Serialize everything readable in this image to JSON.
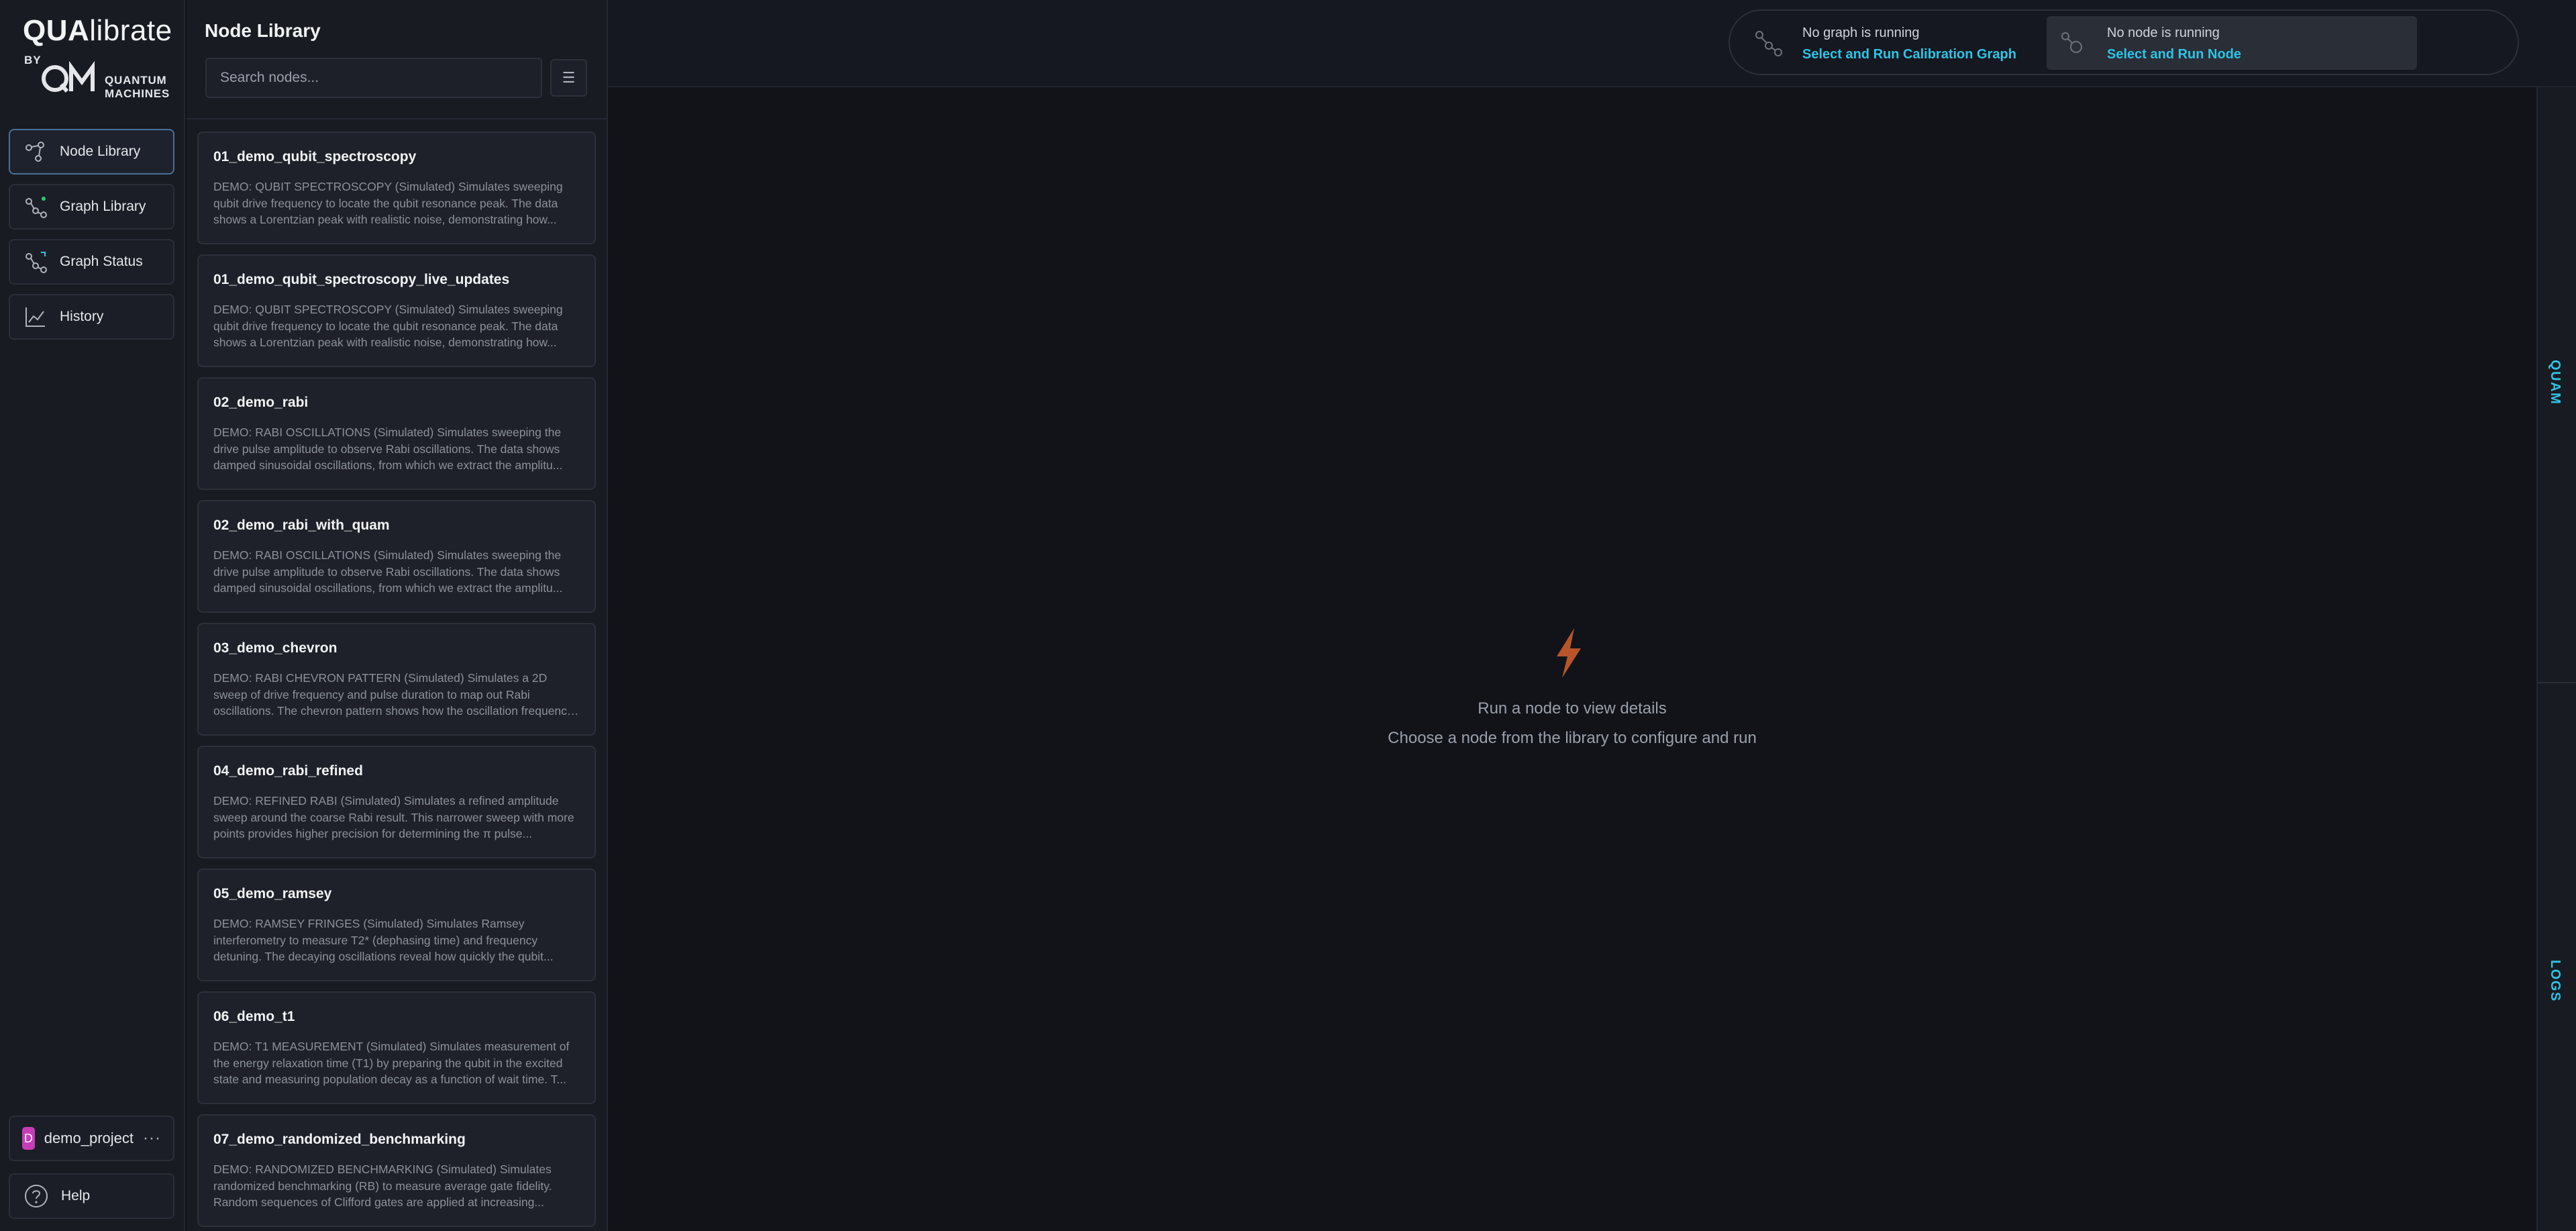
{
  "app": {
    "brand": "QUAlibrate",
    "brand_by": "BY",
    "brand_company_line1": "QUANTUM",
    "brand_company_line2": "MACHINES"
  },
  "sidebar": {
    "items": [
      {
        "label": "Node Library",
        "icon": "node-library-icon",
        "active": true
      },
      {
        "label": "Graph Library",
        "icon": "graph-library-icon",
        "active": false
      },
      {
        "label": "Graph Status",
        "icon": "graph-status-icon",
        "active": false
      },
      {
        "label": "History",
        "icon": "history-chart-icon",
        "active": false
      }
    ],
    "project": {
      "avatar_letter": "D",
      "name": "demo_project",
      "more": "···",
      "avatar_color": "#c73cb7"
    },
    "help": {
      "label": "Help"
    }
  },
  "library": {
    "title": "Node Library",
    "search_placeholder": "Search nodes...",
    "filter_icon": "list-filter-icon",
    "nodes": [
      {
        "name": "01_demo_qubit_spectroscopy",
        "description": "DEMO: QUBIT SPECTROSCOPY (Simulated) Simulates sweeping qubit drive frequency to locate the qubit resonance peak. The data shows a Lorentzian peak with realistic noise, demonstrating how..."
      },
      {
        "name": "01_demo_qubit_spectroscopy_live_updates",
        "description": "DEMO: QUBIT SPECTROSCOPY (Simulated) Simulates sweeping qubit drive frequency to locate the qubit resonance peak. The data shows a Lorentzian peak with realistic noise, demonstrating how..."
      },
      {
        "name": "02_demo_rabi",
        "description": "DEMO: RABI OSCILLATIONS (Simulated) Simulates sweeping the drive pulse amplitude to observe Rabi oscillations. The data shows damped sinusoidal oscillations, from which we extract the amplitu..."
      },
      {
        "name": "02_demo_rabi_with_quam",
        "description": "DEMO: RABI OSCILLATIONS (Simulated) Simulates sweeping the drive pulse amplitude to observe Rabi oscillations. The data shows damped sinusoidal oscillations, from which we extract the amplitu..."
      },
      {
        "name": "03_demo_chevron",
        "description": "DEMO: RABI CHEVRON PATTERN (Simulated) Simulates a 2D sweep of drive frequency and pulse duration to map out Rabi oscillations. The chevron pattern shows how the oscillation frequency depends..."
      },
      {
        "name": "04_demo_rabi_refined",
        "description": "DEMO: REFINED RABI (Simulated) Simulates a refined amplitude sweep around the coarse Rabi result. This narrower sweep with more points provides higher precision for determining the π pulse..."
      },
      {
        "name": "05_demo_ramsey",
        "description": "DEMO: RAMSEY FRINGES (Simulated) Simulates Ramsey interferometry to measure T2* (dephasing time) and frequency detuning. The decaying oscillations reveal how quickly the qubit..."
      },
      {
        "name": "06_demo_t1",
        "description": "DEMO: T1 MEASUREMENT (Simulated) Simulates measurement of the energy relaxation time (T1) by preparing the qubit in the excited state and measuring population decay as a function of wait time. T..."
      },
      {
        "name": "07_demo_randomized_benchmarking",
        "description": "DEMO: RANDOMIZED BENCHMARKING (Simulated) Simulates randomized benchmarking (RB) to measure average gate fidelity. Random sequences of Clifford gates are applied at increasing..."
      }
    ]
  },
  "topbar": {
    "graph": {
      "title": "No graph is running",
      "link": "Select and Run Calibration Graph"
    },
    "node": {
      "title": "No node is running",
      "link": "Select and Run Node"
    }
  },
  "main": {
    "empty_icon": "lightning-bolt-icon",
    "empty_title": "Run a node to view details",
    "empty_subtitle": "Choose a node from the library to configure and run"
  },
  "right_rail": {
    "tabs": [
      {
        "label": "QUAM"
      },
      {
        "label": "LOGS"
      }
    ]
  },
  "colors": {
    "accent": "#2ec4e6",
    "bolt": "#b8552a",
    "active_border": "#4a6f99"
  }
}
